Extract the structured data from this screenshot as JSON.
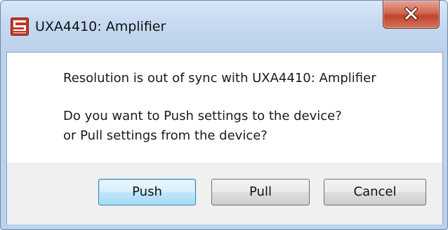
{
  "window": {
    "title": "UXA4410: Amplifier",
    "app_icon": "app-logo-icon",
    "close_icon": "close-icon"
  },
  "message": {
    "line1": "Resolution is out of sync with UXA4410: Amplifier",
    "line2": "Do you want to Push settings to the device?",
    "line3": "or Pull settings from the device?"
  },
  "buttons": {
    "push": "Push",
    "pull": "Pull",
    "cancel": "Cancel"
  },
  "colors": {
    "close_button": "#c8452c",
    "default_button_border": "#3c7fb1",
    "title_bar": "#c6daf0",
    "icon_red": "#c0392b"
  }
}
